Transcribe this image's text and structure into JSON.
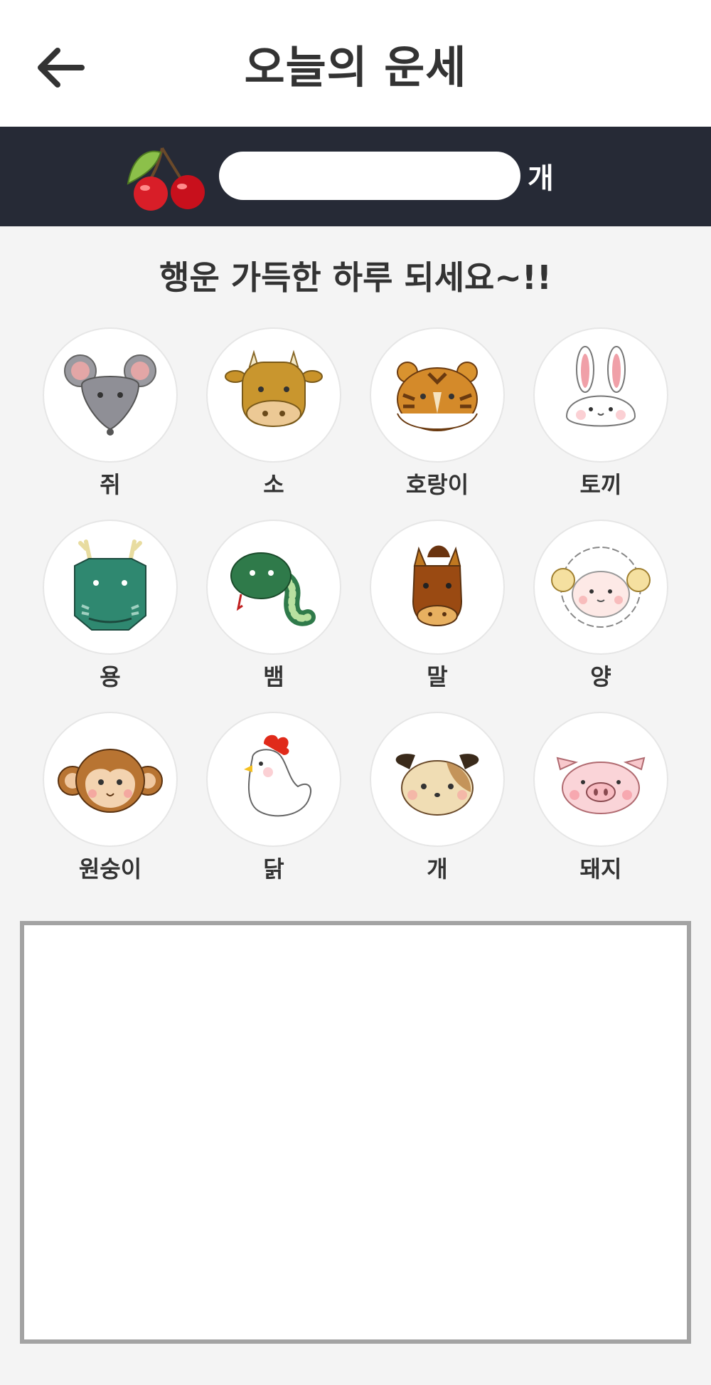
{
  "header": {
    "title": "오늘의 운세",
    "back_icon": "arrow-left-icon"
  },
  "points": {
    "icon": "cherry-icon",
    "value": "",
    "unit": "개"
  },
  "greeting": "행운 가득한 하루 되세요~!!",
  "zodiac": [
    {
      "label": "쥐",
      "icon": "rat-icon"
    },
    {
      "label": "소",
      "icon": "ox-icon"
    },
    {
      "label": "호랑이",
      "icon": "tiger-icon"
    },
    {
      "label": "토끼",
      "icon": "rabbit-icon"
    },
    {
      "label": "용",
      "icon": "dragon-icon"
    },
    {
      "label": "뱀",
      "icon": "snake-icon"
    },
    {
      "label": "말",
      "icon": "horse-icon"
    },
    {
      "label": "양",
      "icon": "sheep-icon"
    },
    {
      "label": "원숭이",
      "icon": "monkey-icon"
    },
    {
      "label": "닭",
      "icon": "rooster-icon"
    },
    {
      "label": "개",
      "icon": "dog-icon"
    },
    {
      "label": "돼지",
      "icon": "pig-icon"
    }
  ],
  "result": {
    "text": ""
  }
}
